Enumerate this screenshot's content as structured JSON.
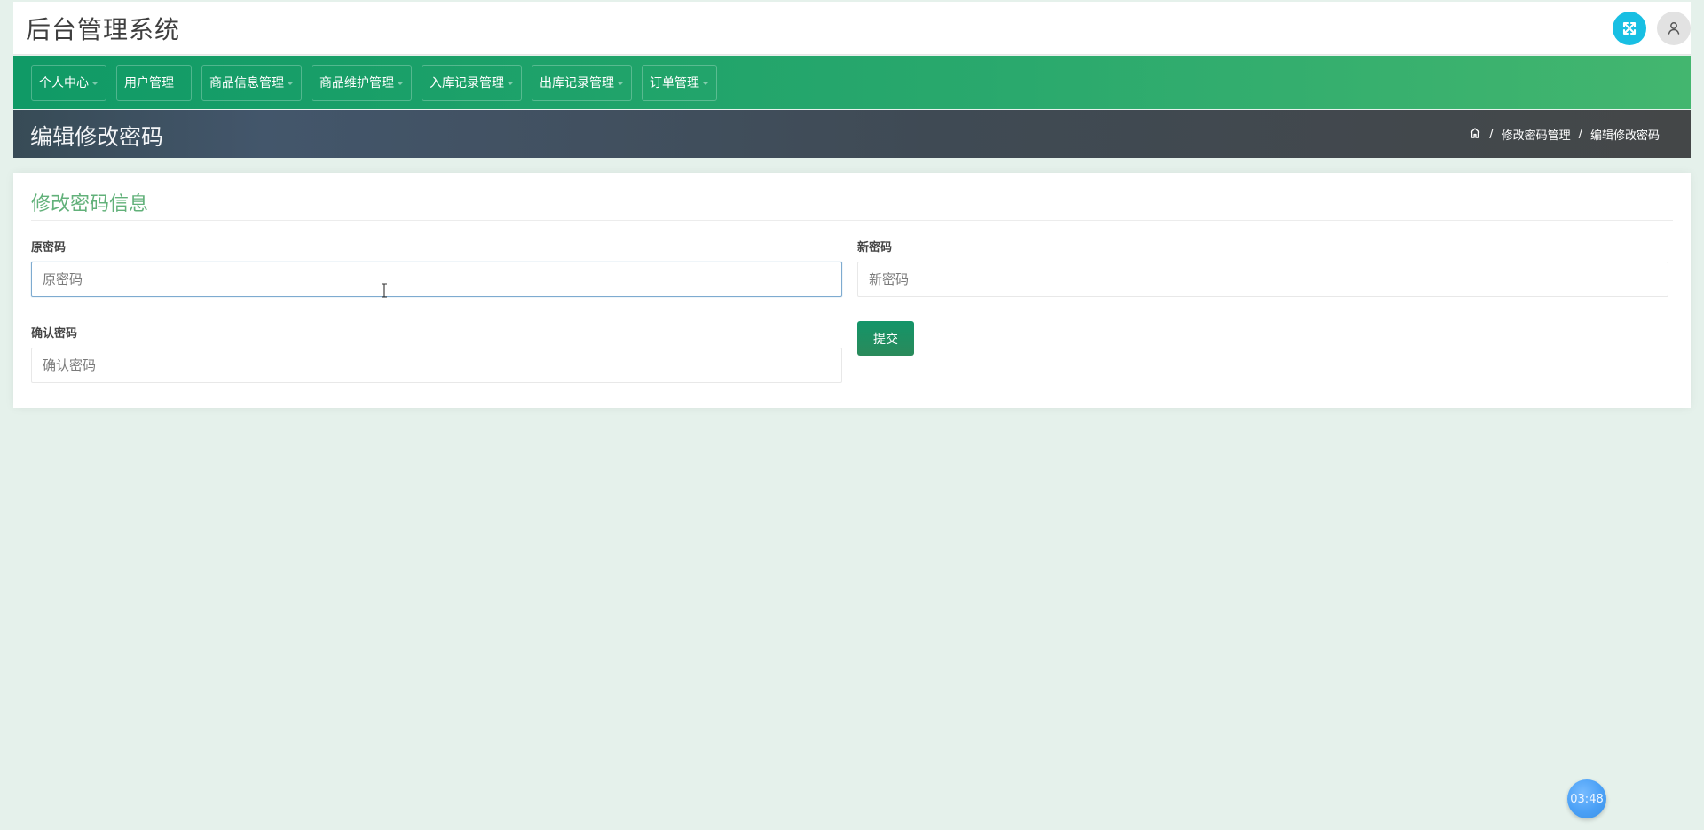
{
  "header": {
    "app_title": "后台管理系统",
    "icons": {
      "expand": "expand-icon",
      "user": "user-icon"
    }
  },
  "nav": {
    "items": [
      {
        "label": "个人中心",
        "has_dropdown": true
      },
      {
        "label": "用户管理",
        "has_dropdown": false
      },
      {
        "label": "商品信息管理",
        "has_dropdown": true
      },
      {
        "label": "商品维护管理",
        "has_dropdown": true
      },
      {
        "label": "入库记录管理",
        "has_dropdown": true
      },
      {
        "label": "出库记录管理",
        "has_dropdown": true
      },
      {
        "label": "订单管理",
        "has_dropdown": true
      }
    ]
  },
  "page": {
    "title": "编辑修改密码",
    "breadcrumb": {
      "home_icon": "home-icon",
      "items": [
        "修改密码管理",
        "编辑修改密码"
      ]
    }
  },
  "form": {
    "title": "修改密码信息",
    "fields": {
      "old_password": {
        "label": "原密码",
        "placeholder": "原密码",
        "value": ""
      },
      "new_password": {
        "label": "新密码",
        "placeholder": "新密码",
        "value": ""
      },
      "confirm_password": {
        "label": "确认密码",
        "placeholder": "确认密码",
        "value": ""
      }
    },
    "submit_label": "提交"
  },
  "timer": {
    "text": "03:48"
  },
  "colors": {
    "page_background": "#e5f1eb",
    "nav_green": "#109a66",
    "title_bar": "#3f4a54",
    "accent_cyan": "#18bfe3",
    "form_title_green": "#62b17a",
    "submit_green": "#139569",
    "timer_blue": "#4aa0f6"
  }
}
